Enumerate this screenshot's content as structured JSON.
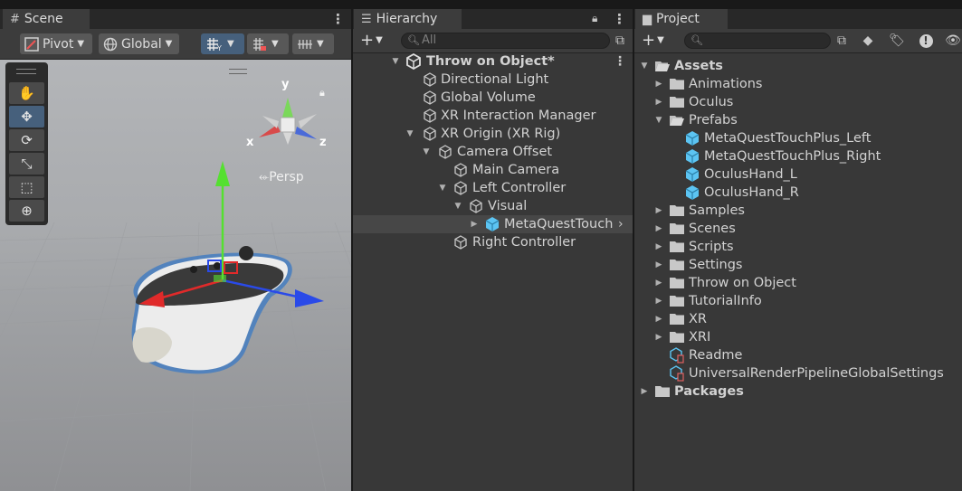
{
  "scene": {
    "tab_title": "Scene",
    "pivot_label": "Pivot",
    "global_label": "Global",
    "persp_label": "⬰Persp",
    "axis_x": "x",
    "axis_y": "y",
    "axis_z": "z"
  },
  "hierarchy": {
    "tab_title": "Hierarchy",
    "search_placeholder": "All",
    "items": [
      {
        "label": "Throw on Object*",
        "depth": 0
      },
      {
        "label": "Directional Light",
        "depth": 1
      },
      {
        "label": "Global Volume",
        "depth": 1
      },
      {
        "label": "XR Interaction Manager",
        "depth": 1
      },
      {
        "label": "XR Origin (XR Rig)",
        "depth": 1
      },
      {
        "label": "Camera Offset",
        "depth": 2
      },
      {
        "label": "Main Camera",
        "depth": 3
      },
      {
        "label": "Left Controller",
        "depth": 3
      },
      {
        "label": "Visual",
        "depth": 4
      },
      {
        "label": "MetaQuestTouch",
        "depth": 5
      },
      {
        "label": "Right Controller",
        "depth": 3
      }
    ]
  },
  "project": {
    "tab_title": "Project",
    "search_placeholder": "",
    "items": [
      {
        "label": "Assets"
      },
      {
        "label": "Animations"
      },
      {
        "label": "Oculus"
      },
      {
        "label": "Prefabs"
      },
      {
        "label": "MetaQuestTouchPlus_Left"
      },
      {
        "label": "MetaQuestTouchPlus_Right"
      },
      {
        "label": "OculusHand_L"
      },
      {
        "label": "OculusHand_R"
      },
      {
        "label": "Samples"
      },
      {
        "label": "Scenes"
      },
      {
        "label": "Scripts"
      },
      {
        "label": "Settings"
      },
      {
        "label": "Throw on Object"
      },
      {
        "label": "TutorialInfo"
      },
      {
        "label": "XR"
      },
      {
        "label": "XRI"
      },
      {
        "label": "Readme"
      },
      {
        "label": "UniversalRenderPipelineGlobalSettings"
      },
      {
        "label": "Packages"
      }
    ]
  },
  "colors": {
    "selection": "#46607c",
    "prefab_blue": "#5cc4f2",
    "gizmo_y": "#44dd22",
    "gizmo_x": "#e02a2a",
    "gizmo_z": "#2a4ae8"
  }
}
